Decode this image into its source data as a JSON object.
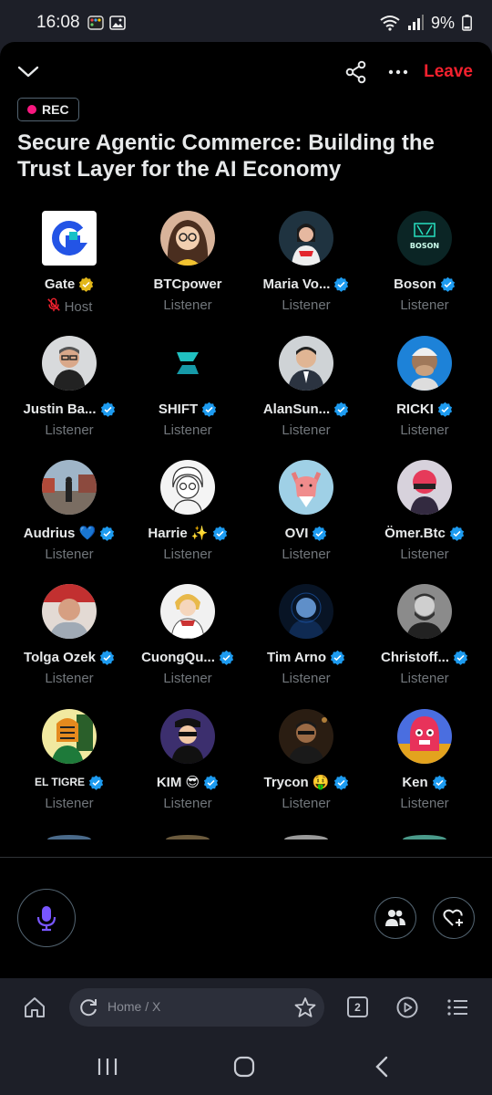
{
  "status": {
    "time": "16:08",
    "battery": "9%"
  },
  "header": {
    "leave": "Leave"
  },
  "rec": "REC",
  "title": "Secure Agentic Commerce: Building the Trust Layer for the AI Economy",
  "participants": [
    {
      "name": "Gate",
      "role": "Host",
      "badge": "gold"
    },
    {
      "name": "BTCpower",
      "role": "Listener",
      "badge": ""
    },
    {
      "name": "Maria Vo...",
      "role": "Listener",
      "badge": "blue"
    },
    {
      "name": "Boson",
      "role": "Listener",
      "badge": "blue"
    },
    {
      "name": "Justin Ba...",
      "role": "Listener",
      "badge": "blue"
    },
    {
      "name": "SHIFT",
      "role": "Listener",
      "badge": "blue"
    },
    {
      "name": "AlanSun...",
      "role": "Listener",
      "badge": "blue"
    },
    {
      "name": "RICKI",
      "role": "Listener",
      "badge": "blue"
    },
    {
      "name": "Audrius 💙",
      "role": "Listener",
      "badge": "blue"
    },
    {
      "name": "Harrie ✨",
      "role": "Listener",
      "badge": "blue"
    },
    {
      "name": "OVI",
      "role": "Listener",
      "badge": "blue"
    },
    {
      "name": "Ömer.Btc",
      "role": "Listener",
      "badge": "blue"
    },
    {
      "name": "Tolga Ozek",
      "role": "Listener",
      "badge": "blue"
    },
    {
      "name": "CuongQu...",
      "role": "Listener",
      "badge": "blue"
    },
    {
      "name": "Tim Arno",
      "role": "Listener",
      "badge": "blue"
    },
    {
      "name": "Christoff...",
      "role": "Listener",
      "badge": "blue"
    },
    {
      "name": "EL TIGRE",
      "role": "Listener",
      "badge": "blue"
    },
    {
      "name": "KIM 😎",
      "role": "Listener",
      "badge": "blue"
    },
    {
      "name": "Trycon 🤑",
      "role": "Listener",
      "badge": "blue"
    },
    {
      "name": "Ken",
      "role": "Listener",
      "badge": "blue"
    }
  ],
  "browser": {
    "url": "Home / X",
    "tabs": "2"
  },
  "colors": {
    "accent_blue": "#1d9bf0",
    "leave_red": "#f4212e",
    "mic_purple": "#7856ff"
  }
}
